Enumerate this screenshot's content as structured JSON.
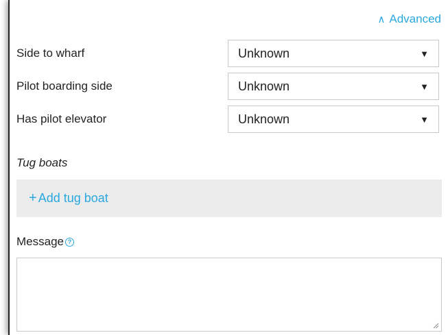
{
  "advanced_toggle": {
    "label": "Advanced",
    "icon": "chevron-up-icon"
  },
  "fields": [
    {
      "label": "Side to wharf",
      "value": "Unknown"
    },
    {
      "label": "Pilot boarding side",
      "value": "Unknown"
    },
    {
      "label": "Has pilot elevator",
      "value": "Unknown"
    }
  ],
  "tug_boats": {
    "title": "Tug boats",
    "add_label": "Add tug boat",
    "add_icon": "plus-icon"
  },
  "message": {
    "label": "Message",
    "help_icon": "help-circle-icon",
    "value": ""
  },
  "colors": {
    "accent": "#29a8e0",
    "text": "#222222",
    "border": "#c8c8c8",
    "tug_bg": "#ececec"
  }
}
